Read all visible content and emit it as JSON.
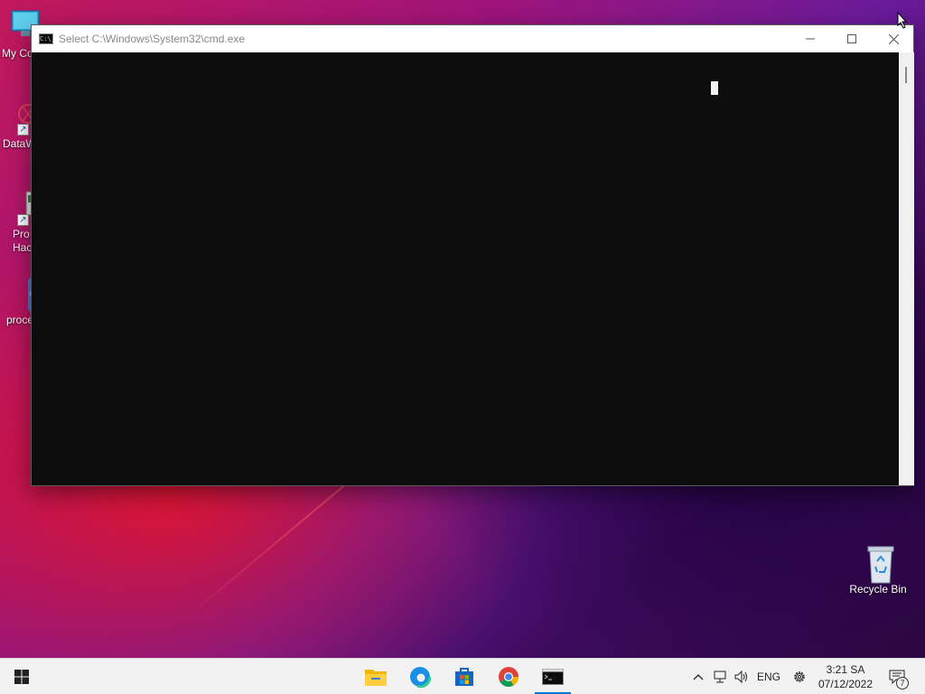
{
  "desktop": {
    "icons": [
      {
        "label": "My Co"
      },
      {
        "label": "DataW"
      },
      {
        "label": "Pro\nHac"
      },
      {
        "label": "proce"
      },
      {
        "label": "Recycle Bin"
      }
    ]
  },
  "window": {
    "title": "Select C:\\Windows\\System32\\cmd.exe",
    "icon_text": "C:\\_",
    "minimize_icon": "minimize-icon",
    "maximize_icon": "maximize-icon",
    "close_icon": "close-icon"
  },
  "taskbar": {
    "apps": [
      "start",
      "file-explorer",
      "edge",
      "store",
      "chrome",
      "cmd"
    ],
    "tray": {
      "language": "ENG",
      "time": "3:21 SA",
      "date": "07/12/2022",
      "notifications": "7"
    }
  },
  "colors": {
    "console_bg": "#0c0c0c",
    "accent": "#0078d4"
  }
}
